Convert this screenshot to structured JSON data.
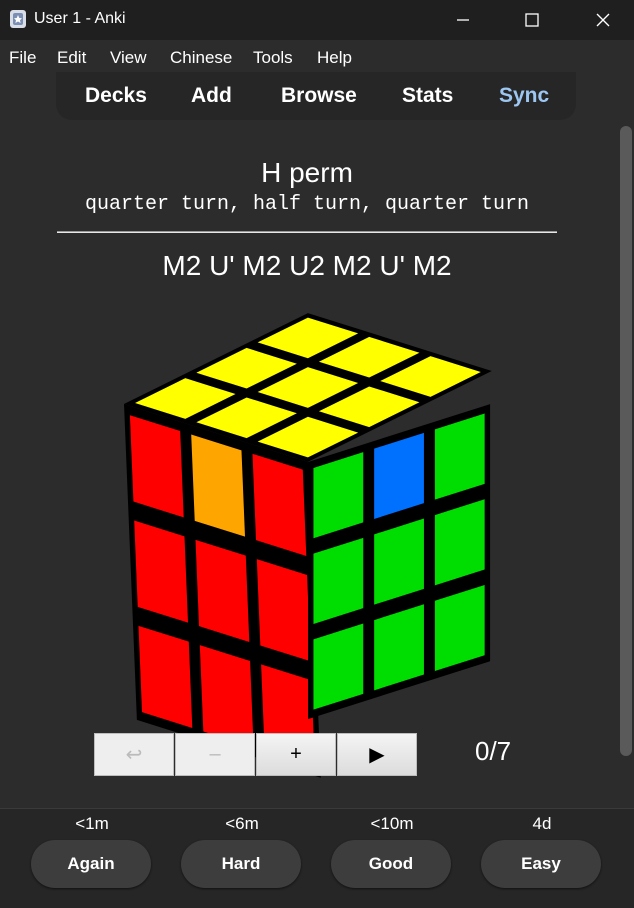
{
  "window": {
    "title": "User 1 - Anki"
  },
  "menu": {
    "file": "File",
    "edit": "Edit",
    "view": "View",
    "chinese": "Chinese",
    "tools": "Tools",
    "help": "Help"
  },
  "toolbar": {
    "decks": "Decks",
    "add": "Add",
    "browse": "Browse",
    "stats": "Stats",
    "sync": "Sync"
  },
  "card": {
    "title": "H perm",
    "subtitle": "quarter turn, half turn, quarter turn",
    "algorithm": "M2 U' M2 U2 M2 U' M2"
  },
  "player": {
    "back": "↩",
    "minus": "–",
    "plus": "+",
    "play": "▶",
    "counter": "0/7"
  },
  "cube_colors": {
    "top": "#ffff00",
    "front_left": "#ff0000",
    "front_right": "#00dd00",
    "orange": "#ffa500",
    "blue": "#0070ff"
  },
  "answers": [
    {
      "interval": "<1m",
      "label": "Again"
    },
    {
      "interval": "<6m",
      "label": "Hard"
    },
    {
      "interval": "<10m",
      "label": "Good"
    },
    {
      "interval": "4d",
      "label": "Easy"
    }
  ]
}
